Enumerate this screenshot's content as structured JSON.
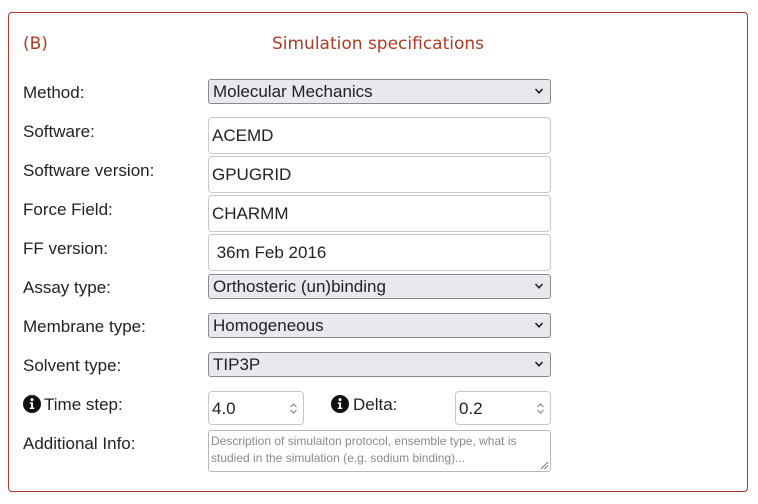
{
  "header": {
    "section_letter": "(B)",
    "title": "Simulation specifications"
  },
  "form": {
    "method": {
      "label": "Method:",
      "value": "Molecular Mechanics"
    },
    "software": {
      "label": "Software:",
      "value": "ACEMD"
    },
    "software_version": {
      "label": "Software version:",
      "value": "GPUGRID"
    },
    "force_field": {
      "label": "Force Field:",
      "value": "CHARMM"
    },
    "ff_version": {
      "label": "FF version:",
      "value": " 36m Feb 2016"
    },
    "assay_type": {
      "label": "Assay type:",
      "value": "Orthosteric (un)binding"
    },
    "membrane_type": {
      "label": "Membrane type:",
      "value": "Homogeneous"
    },
    "solvent_type": {
      "label": "Solvent type:",
      "value": "TIP3P"
    },
    "time_step": {
      "label": "Time step:",
      "value": "4.0",
      "icon": "info-icon"
    },
    "delta": {
      "label": "Delta:",
      "value": "0.2",
      "icon": "info-icon"
    },
    "additional_info": {
      "label": "Additional Info:",
      "placeholder": "Description of simulaiton protocol, ensemble type, what is studied in the simulation (e.g. sodium binding)..."
    }
  },
  "colors": {
    "accent": "#b03a24",
    "select_bg": "#e8e8ee"
  }
}
